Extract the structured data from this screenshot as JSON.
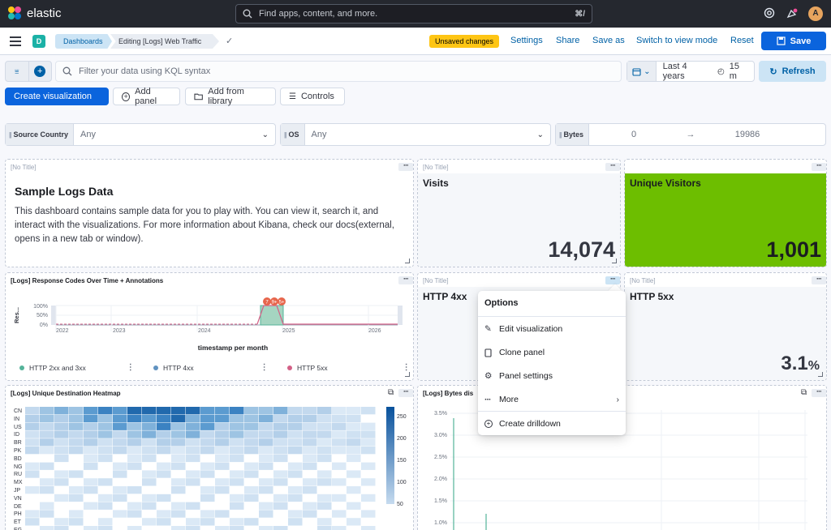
{
  "topbar": {
    "brand": "elastic",
    "search_placeholder": "Find apps, content, and more.",
    "search_shortcut": "⌘/",
    "user_initial": "A"
  },
  "header": {
    "space_initial": "D",
    "breadcrumbs": [
      "Dashboards",
      "Editing [Logs] Web Traffic"
    ],
    "unsaved": "Unsaved changes",
    "links": [
      "Settings",
      "Share",
      "Save as",
      "Switch to view mode",
      "Reset"
    ],
    "save": "Save"
  },
  "query": {
    "placeholder": "Filter your data using KQL syntax",
    "time_range": "Last 4 years",
    "refresh_interval": "15 m",
    "refresh": "Refresh"
  },
  "toolbar": {
    "create": "Create visualization",
    "add_panel": "Add panel",
    "add_library": "Add from library",
    "controls": "Controls"
  },
  "controls": [
    {
      "label": "Source Country",
      "value": "Any"
    },
    {
      "label": "OS",
      "value": "Any"
    },
    {
      "label": "Bytes",
      "min": "0",
      "max": "19986"
    }
  ],
  "panels": {
    "no_title": "[No Title]",
    "markdown": {
      "heading": "Sample Logs Data",
      "body": "This dashboard contains sample data for you to play with. You can view it, search it, and interact with the visualizations. For more information about Kibana, check our docs(external, opens in a new tab or window)."
    },
    "visits": {
      "label": "Visits",
      "value": "14,074"
    },
    "unique": {
      "label": "Unique Visitors",
      "value": "1,001"
    },
    "http4xx": {
      "label": "HTTP 4xx"
    },
    "http5xx": {
      "label": "HTTP 5xx",
      "value": "3.1",
      "unit": "%"
    },
    "response_codes": {
      "title": "[Logs] Response Codes Over Time + Annotations",
      "yaxis": "Res...",
      "xlabel": "timestamp per month",
      "yticks": [
        "100%",
        "50%",
        "0%"
      ],
      "xticks": [
        "2022",
        "2023",
        "2024",
        "2025",
        "2026"
      ],
      "annotations": [
        "7",
        "9+",
        "5+"
      ],
      "legend": [
        "HTTP 2xx and 3xx",
        "HTTP 4xx",
        "HTTP 5xx"
      ]
    },
    "heatmap": {
      "title": "[Logs] Unique Destination Heatmap",
      "rows": [
        "CN",
        "IN",
        "US",
        "ID",
        "BR",
        "PK",
        "BD",
        "NG",
        "RU",
        "MX",
        "JP",
        "VN",
        "DE",
        "PH",
        "ET",
        "EG"
      ],
      "scale": [
        "250",
        "200",
        "150",
        "100",
        "50"
      ]
    },
    "bytes": {
      "title": "[Logs] Bytes dis",
      "yticks": [
        "3.5%",
        "3.0%",
        "2.5%",
        "2.0%",
        "1.5%",
        "1.0%"
      ]
    }
  },
  "popover": {
    "title": "Options",
    "items": [
      "Edit visualization",
      "Clone panel",
      "Panel settings",
      "More",
      "Create drilldown"
    ]
  },
  "colors": {
    "topbar": "#25282f",
    "primary": "#0b64dd",
    "unique_bg": "#6dbe00",
    "legend_2xx": "#54b399",
    "legend_4xx": "#6092c0",
    "legend_5xx": "#d36086",
    "annotation": "#e7664c"
  }
}
